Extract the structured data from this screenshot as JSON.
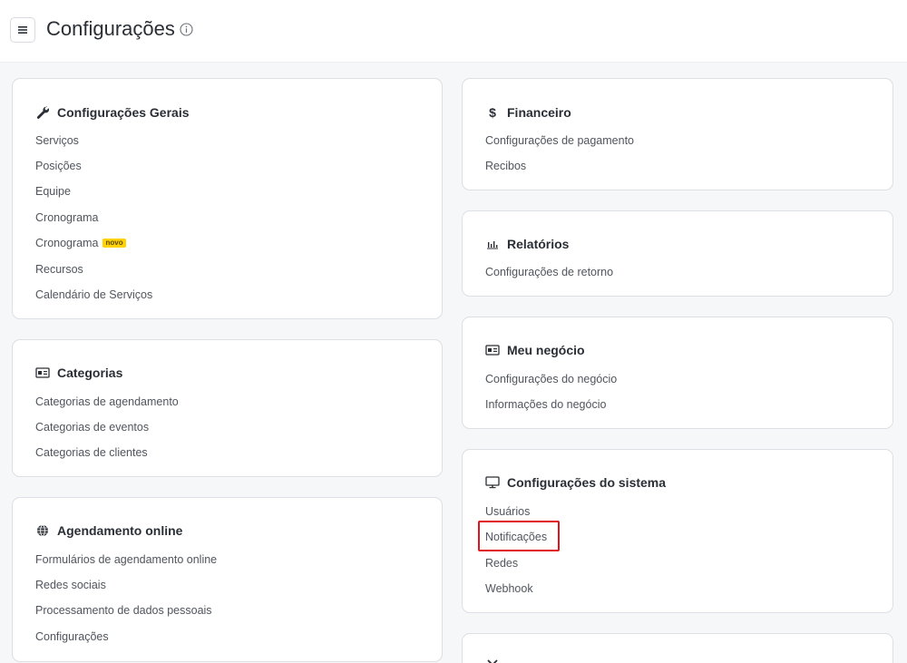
{
  "header": {
    "title": "Configurações"
  },
  "cards": {
    "general": {
      "title": "Configurações Gerais",
      "items": [
        "Serviços",
        "Posições",
        "Equipe",
        "Cronograma",
        "Cronograma",
        "Recursos",
        "Calendário de Serviços"
      ],
      "badge": "novo"
    },
    "categories": {
      "title": "Categorias",
      "items": [
        "Categorias de agendamento",
        "Categorias de eventos",
        "Categorias de clientes"
      ]
    },
    "online": {
      "title": "Agendamento online",
      "items": [
        "Formulários de agendamento online",
        "Redes sociais",
        "Processamento de dados pessoais",
        "Configurações"
      ]
    },
    "finance": {
      "title": "Financeiro",
      "items": [
        "Configurações de pagamento",
        "Recibos"
      ]
    },
    "reports": {
      "title": "Relatórios",
      "items": [
        "Configurações de retorno"
      ]
    },
    "business": {
      "title": "Meu negócio",
      "items": [
        "Configurações do negócio",
        "Informações do negócio"
      ]
    },
    "system": {
      "title": "Configurações do sistema",
      "items": [
        "Usuários",
        "Notificações",
        "Redes",
        "Webhook"
      ]
    }
  },
  "colors": {
    "highlight": "#e0141e",
    "badge": "#ffd200"
  }
}
